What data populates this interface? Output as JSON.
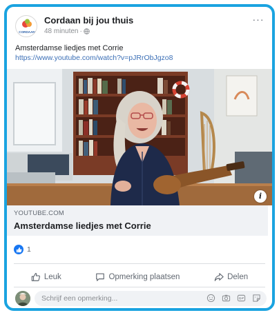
{
  "post": {
    "page_name": "Cordaan bij jou thuis",
    "timestamp": "48 minuten",
    "meta_separator": "·",
    "text": "Amsterdamse liedjes met Corrie",
    "link": "https://www.youtube.com/watch?v=pJRrObJgzo8",
    "avatar_logo_text": "CORDAAN"
  },
  "preview": {
    "domain": "YOUTUBE.COM",
    "title": "Amsterdamse liedjes met Corrie"
  },
  "reactions": {
    "count": "1"
  },
  "actions": {
    "like_label": "Leuk",
    "comment_label": "Opmerking plaatsen",
    "share_label": "Delen"
  },
  "comment": {
    "placeholder": "Schrijf een opmerking..."
  },
  "colors": {
    "frame": "#1aa3e0",
    "link": "#3b6fb6",
    "like": "#1877f2"
  }
}
